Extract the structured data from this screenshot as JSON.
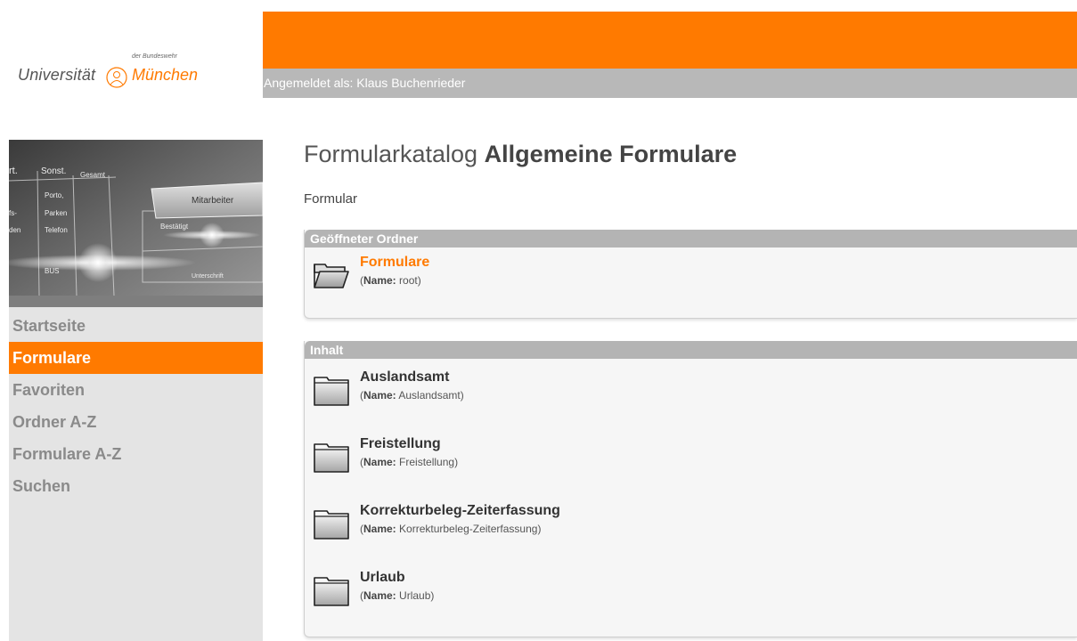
{
  "logo": {
    "small": "der Bundeswehr",
    "uni": "Universität",
    "city": "München"
  },
  "header": {
    "login_text": "Angemeldet als: Klaus Buchenrieder"
  },
  "banner": {
    "col1": "Sonst.",
    "col2": "Gesamt",
    "rows": [
      "Porto,",
      "Parken",
      "Telefon"
    ],
    "left_rows": [
      "rt.",
      "fs-",
      "den"
    ],
    "tab_label": "Mitarbeiter",
    "confirm_label": "Bestätigt",
    "sign_label": "Unterschrift",
    "code": "BUS"
  },
  "sidebar": {
    "items": [
      {
        "label": "Startseite"
      },
      {
        "label": "Formulare"
      },
      {
        "label": "Favoriten"
      },
      {
        "label": "Ordner A-Z"
      },
      {
        "label": "Formulare A-Z"
      },
      {
        "label": "Suchen"
      }
    ]
  },
  "main": {
    "title_prefix": "Formularkatalog",
    "title_bold": "Allgemeine Formulare",
    "breadcrumb": "Formular",
    "name_label": "Name:",
    "open_folder": {
      "heading": "Geöffneter Ordner",
      "name": "Formulare",
      "internal": "root"
    },
    "content": {
      "heading": "Inhalt",
      "folders": [
        {
          "name": "Auslandsamt",
          "internal": "Auslandsamt"
        },
        {
          "name": "Freistellung",
          "internal": "Freistellung"
        },
        {
          "name": "Korrekturbeleg-Zeiterfassung",
          "internal": "Korrekturbeleg-Zeiterfassung"
        },
        {
          "name": "Urlaub",
          "internal": "Urlaub"
        }
      ]
    }
  },
  "colors": {
    "accent": "#ff7a00",
    "gray_bar": "#b8b8b8",
    "sidebar_bg": "#e4e4e4"
  }
}
